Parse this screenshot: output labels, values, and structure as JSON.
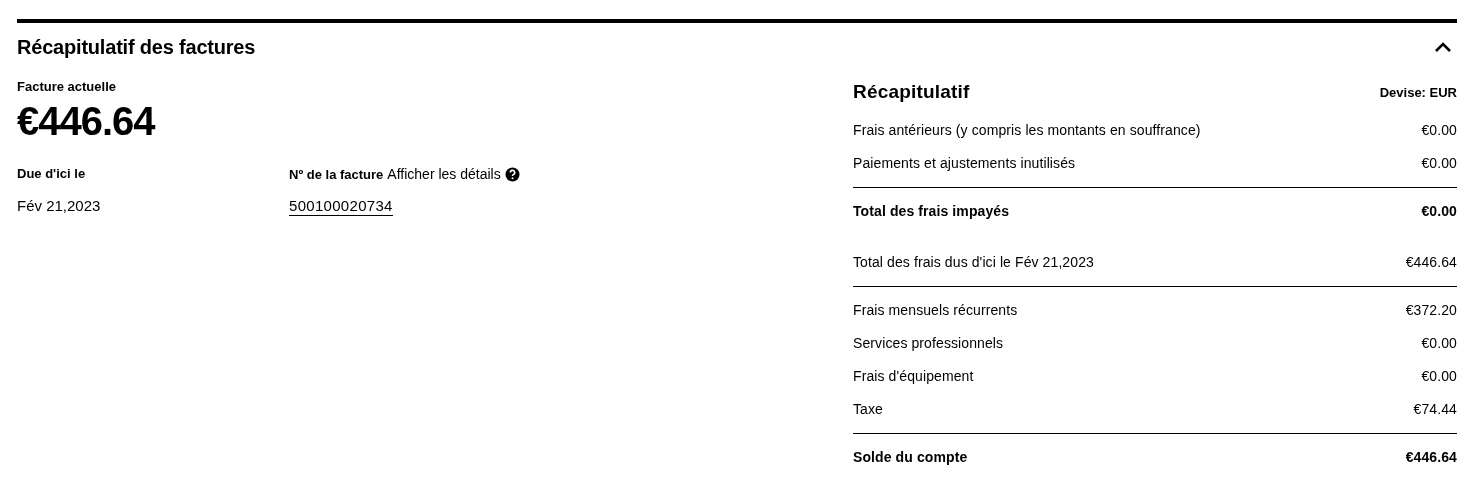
{
  "section": {
    "title": "Récapitulatif des factures",
    "expanded": true
  },
  "current_bill": {
    "label": "Facture actuelle",
    "amount": "€446.64"
  },
  "due": {
    "label": "Due d'ici le",
    "value": "Fév 21,2023"
  },
  "invoice": {
    "label": "Nº de la facture",
    "link": "Afficher les détails",
    "number": "500100020734"
  },
  "summary": {
    "title": "Récapitulatif",
    "currency": "Devise: EUR",
    "groups": [
      {
        "divider_above": false,
        "rows": [
          {
            "label": "Frais antérieurs (y compris les montants en souffrance)",
            "value": "€0.00",
            "emphasis": false
          },
          {
            "label": "Paiements et ajustements inutilisés",
            "value": "€0.00",
            "emphasis": false
          }
        ]
      },
      {
        "divider_above": true,
        "rows": [
          {
            "label": "Total des frais impayés",
            "value": "€0.00",
            "emphasis": true
          }
        ]
      },
      {
        "divider_above": false,
        "rows": [
          {
            "label": "Total des frais dus d'ici le Fév 21,2023",
            "value": "€446.64",
            "emphasis": false
          }
        ]
      },
      {
        "divider_above": true,
        "rows": [
          {
            "label": "Frais mensuels récurrents",
            "value": "€372.20",
            "emphasis": false
          },
          {
            "label": "Services professionnels",
            "value": "€0.00",
            "emphasis": false
          },
          {
            "label": "Frais d'équipement",
            "value": "€0.00",
            "emphasis": false
          },
          {
            "label": "Taxe",
            "value": "€74.44",
            "emphasis": false
          }
        ]
      },
      {
        "divider_above": true,
        "rows": [
          {
            "label": "Solde du compte",
            "value": "€446.64",
            "emphasis": true
          }
        ]
      }
    ]
  }
}
